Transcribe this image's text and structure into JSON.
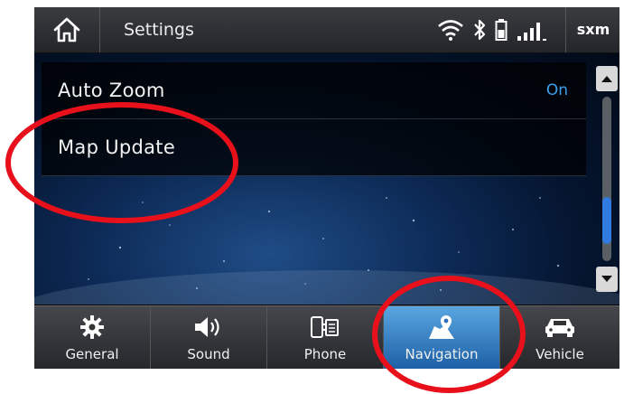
{
  "header": {
    "title": "Settings",
    "sxm_label": "sxm"
  },
  "settings_list": [
    {
      "label": "Auto Zoom",
      "value": "On"
    },
    {
      "label": "Map Update",
      "value": ""
    }
  ],
  "scrollbar": {
    "position_fraction": 0.85
  },
  "bottom_nav": [
    {
      "label": "General",
      "icon": "gear-icon",
      "active": false
    },
    {
      "label": "Sound",
      "icon": "speaker-icon",
      "active": false
    },
    {
      "label": "Phone",
      "icon": "phone-icon",
      "active": false
    },
    {
      "label": "Navigation",
      "icon": "map-pin-icon",
      "active": true
    },
    {
      "label": "Vehicle",
      "icon": "car-icon",
      "active": false
    }
  ],
  "colors": {
    "accent": "#3aa0f0",
    "active_tab": "#2f7be0",
    "annotation": "#e8101a"
  }
}
